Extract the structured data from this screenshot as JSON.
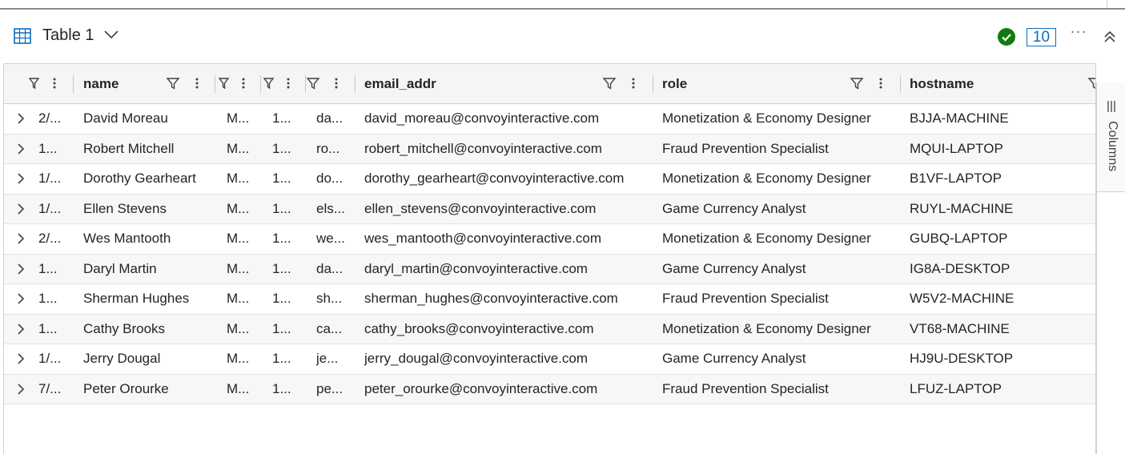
{
  "toolbar": {
    "table_title": "Table 1",
    "row_count": "10",
    "more_label": "···",
    "icons": [
      "table-icon",
      "chevron-down-icon",
      "check-circle-icon",
      "more-icon",
      "collapse-up-icon"
    ],
    "colors": {
      "check": "#107c10",
      "count": "#0f6cbd"
    }
  },
  "columns": [
    {
      "key": "date",
      "label": ""
    },
    {
      "key": "name",
      "label": "name"
    },
    {
      "key": "c3",
      "label": ""
    },
    {
      "key": "c4",
      "label": ""
    },
    {
      "key": "c5",
      "label": ""
    },
    {
      "key": "email_addr",
      "label": "email_addr"
    },
    {
      "key": "role",
      "label": "role"
    },
    {
      "key": "hostname",
      "label": "hostname"
    }
  ],
  "rows": [
    {
      "date": "2/...",
      "name": "David Moreau",
      "c3": "M...",
      "c4": "1...",
      "c5": "da...",
      "email": "david_moreau@convoyinteractive.com",
      "role": "Monetization & Economy Designer",
      "hostname": "BJJA-MACHINE"
    },
    {
      "date": "1...",
      "name": "Robert Mitchell",
      "c3": "M...",
      "c4": "1...",
      "c5": "ro...",
      "email": "robert_mitchell@convoyinteractive.com",
      "role": "Fraud Prevention Specialist",
      "hostname": "MQUI-LAPTOP"
    },
    {
      "date": "1/...",
      "name": "Dorothy Gearheart",
      "c3": "M...",
      "c4": "1...",
      "c5": "do...",
      "email": "dorothy_gearheart@convoyinteractive.com",
      "role": "Monetization & Economy Designer",
      "hostname": "B1VF-LAPTOP"
    },
    {
      "date": "1/...",
      "name": "Ellen Stevens",
      "c3": "M...",
      "c4": "1...",
      "c5": "els...",
      "email": "ellen_stevens@convoyinteractive.com",
      "role": "Game Currency Analyst",
      "hostname": "RUYL-MACHINE"
    },
    {
      "date": "2/...",
      "name": "Wes Mantooth",
      "c3": "M...",
      "c4": "1...",
      "c5": "we...",
      "email": "wes_mantooth@convoyinteractive.com",
      "role": "Monetization & Economy Designer",
      "hostname": "GUBQ-LAPTOP"
    },
    {
      "date": "1...",
      "name": "Daryl Martin",
      "c3": "M...",
      "c4": "1...",
      "c5": "da...",
      "email": "daryl_martin@convoyinteractive.com",
      "role": "Game Currency Analyst",
      "hostname": "IG8A-DESKTOP"
    },
    {
      "date": "1...",
      "name": "Sherman Hughes",
      "c3": "M...",
      "c4": "1...",
      "c5": "sh...",
      "email": "sherman_hughes@convoyinteractive.com",
      "role": "Fraud Prevention Specialist",
      "hostname": "W5V2-MACHINE"
    },
    {
      "date": "1...",
      "name": "Cathy Brooks",
      "c3": "M...",
      "c4": "1...",
      "c5": "ca...",
      "email": "cathy_brooks@convoyinteractive.com",
      "role": "Monetization & Economy Designer",
      "hostname": "VT68-MACHINE"
    },
    {
      "date": "1/...",
      "name": "Jerry Dougal",
      "c3": "M...",
      "c4": "1...",
      "c5": "je...",
      "email": "jerry_dougal@convoyinteractive.com",
      "role": "Game Currency Analyst",
      "hostname": "HJ9U-DESKTOP"
    },
    {
      "date": "7/...",
      "name": "Peter Orourke",
      "c3": "M...",
      "c4": "1...",
      "c5": "pe...",
      "email": "peter_orourke@convoyinteractive.com",
      "role": "Fraud Prevention Specialist",
      "hostname": "LFUZ-LAPTOP"
    }
  ],
  "side_panel": {
    "label": "Columns"
  }
}
